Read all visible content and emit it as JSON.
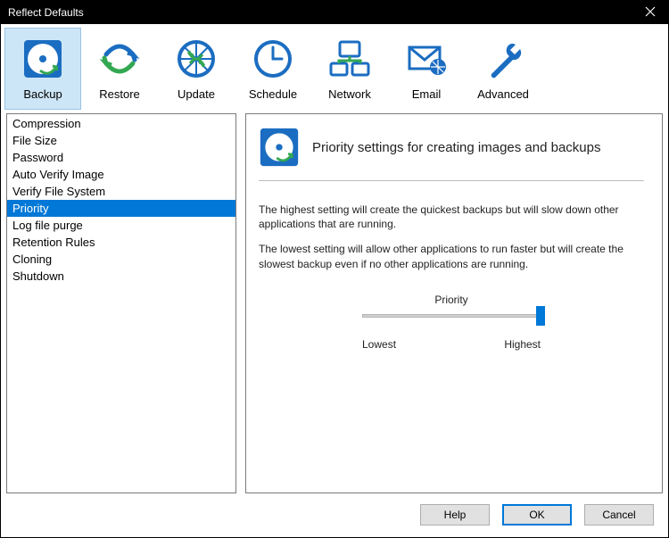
{
  "window": {
    "title": "Reflect Defaults"
  },
  "toolbar": {
    "items": [
      {
        "label": "Backup",
        "icon": "backup-icon",
        "active": true
      },
      {
        "label": "Restore",
        "icon": "restore-icon",
        "active": false
      },
      {
        "label": "Update",
        "icon": "update-icon",
        "active": false
      },
      {
        "label": "Schedule",
        "icon": "schedule-icon",
        "active": false
      },
      {
        "label": "Network",
        "icon": "network-icon",
        "active": false
      },
      {
        "label": "Email",
        "icon": "email-icon",
        "active": false
      },
      {
        "label": "Advanced",
        "icon": "advanced-icon",
        "active": false
      }
    ]
  },
  "sidebar": {
    "items": [
      {
        "label": "Compression",
        "selected": false
      },
      {
        "label": "File Size",
        "selected": false
      },
      {
        "label": "Password",
        "selected": false
      },
      {
        "label": "Auto Verify Image",
        "selected": false
      },
      {
        "label": "Verify File System",
        "selected": false
      },
      {
        "label": "Priority",
        "selected": true
      },
      {
        "label": "Log file purge",
        "selected": false
      },
      {
        "label": "Retention Rules",
        "selected": false
      },
      {
        "label": "Cloning",
        "selected": false
      },
      {
        "label": "Shutdown",
        "selected": false
      }
    ]
  },
  "panel": {
    "title": "Priority settings for creating images and backups",
    "paragraph1": "The highest setting will create the quickest backups but will slow down other applications that are running.",
    "paragraph2": "The lowest setting will allow other applications to run faster but will create the slowest backup even if no other applications are running.",
    "sliderLabel": "Priority",
    "sliderLow": "Lowest",
    "sliderHigh": "Highest",
    "sliderValue": 100
  },
  "footer": {
    "help": "Help",
    "ok": "OK",
    "cancel": "Cancel"
  }
}
